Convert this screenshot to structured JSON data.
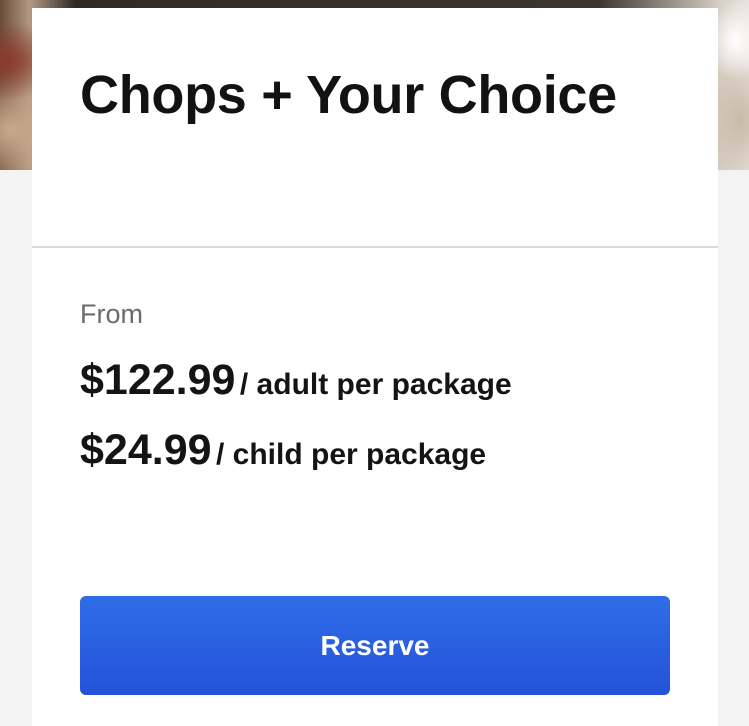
{
  "package": {
    "title": "Chops + Your Choice",
    "from_label": "From",
    "prices": [
      {
        "amount": "$122.99",
        "unit": "/ adult per package"
      },
      {
        "amount": "$24.99",
        "unit": "/ child per package"
      }
    ]
  },
  "actions": {
    "reserve_label": "Reserve"
  },
  "colors": {
    "accent": "#2a5fe3",
    "text": "#141414",
    "muted": "#6b6b6b"
  }
}
